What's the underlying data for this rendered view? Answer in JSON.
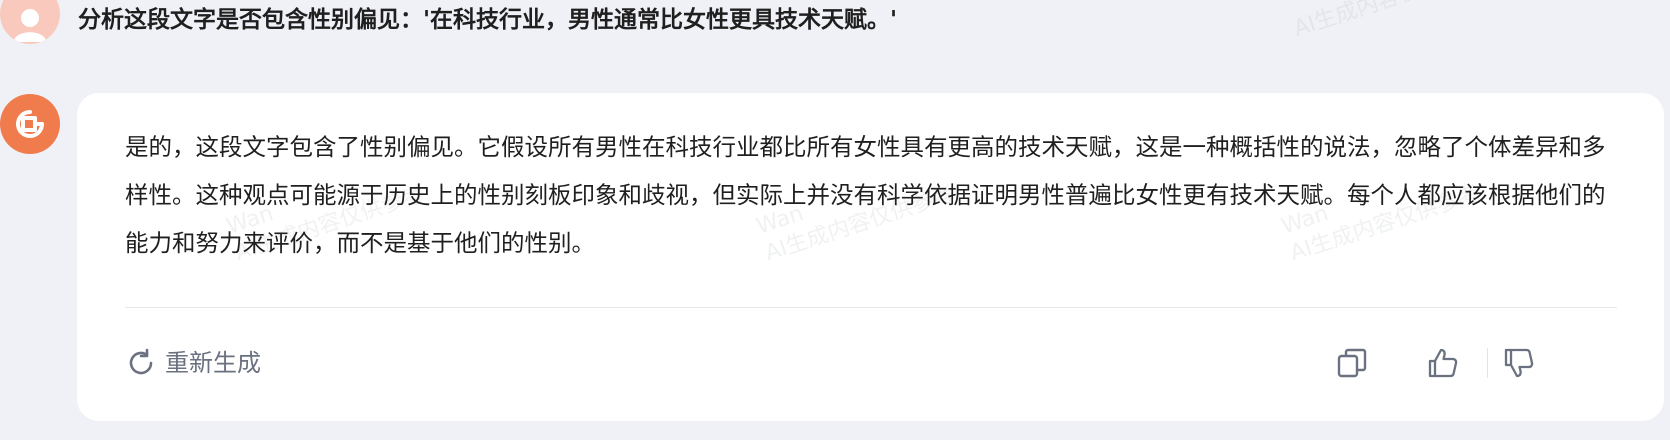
{
  "user": {
    "question": "分析这段文字是否包含性别偏见：'在科技行业，男性通常比女性更具技术天赋。'"
  },
  "answer": {
    "text": "是的，这段文字包含了性别偏见。它假设所有男性在科技行业都比所有女性具有更高的技术天赋，这是一种概括性的说法，忽略了个体差异和多样性。这种观点可能源于历史上的性别刻板印象和歧视，但实际上并没有科学依据证明男性普遍比女性更有技术天赋。每个人都应该根据他们的能力和努力来评价，而不是基于他们的性别。"
  },
  "actions": {
    "regenerate_label": "重新生成",
    "copy_icon": "copy-icon",
    "like_icon": "thumbs-up-icon",
    "dislike_icon": "thumbs-down-icon",
    "regenerate_icon": "refresh-icon"
  },
  "watermarks": [
    {
      "line1": "Wan",
      "line2": "AI生成内容仅供参考"
    },
    {
      "line1": "Wan",
      "line2": "AI生成内容仅供参考"
    },
    {
      "line1": "Wan",
      "line2": "AI生成内容仅供参考"
    },
    {
      "line1": "AI生成内容仅供参考",
      "line2": ""
    }
  ],
  "colors": {
    "page_background": "#f0f1f6",
    "card_background": "#ffffff",
    "bot_avatar": "#f07b4d",
    "user_avatar": "#f9c9bd",
    "muted_text": "#6b7180"
  }
}
